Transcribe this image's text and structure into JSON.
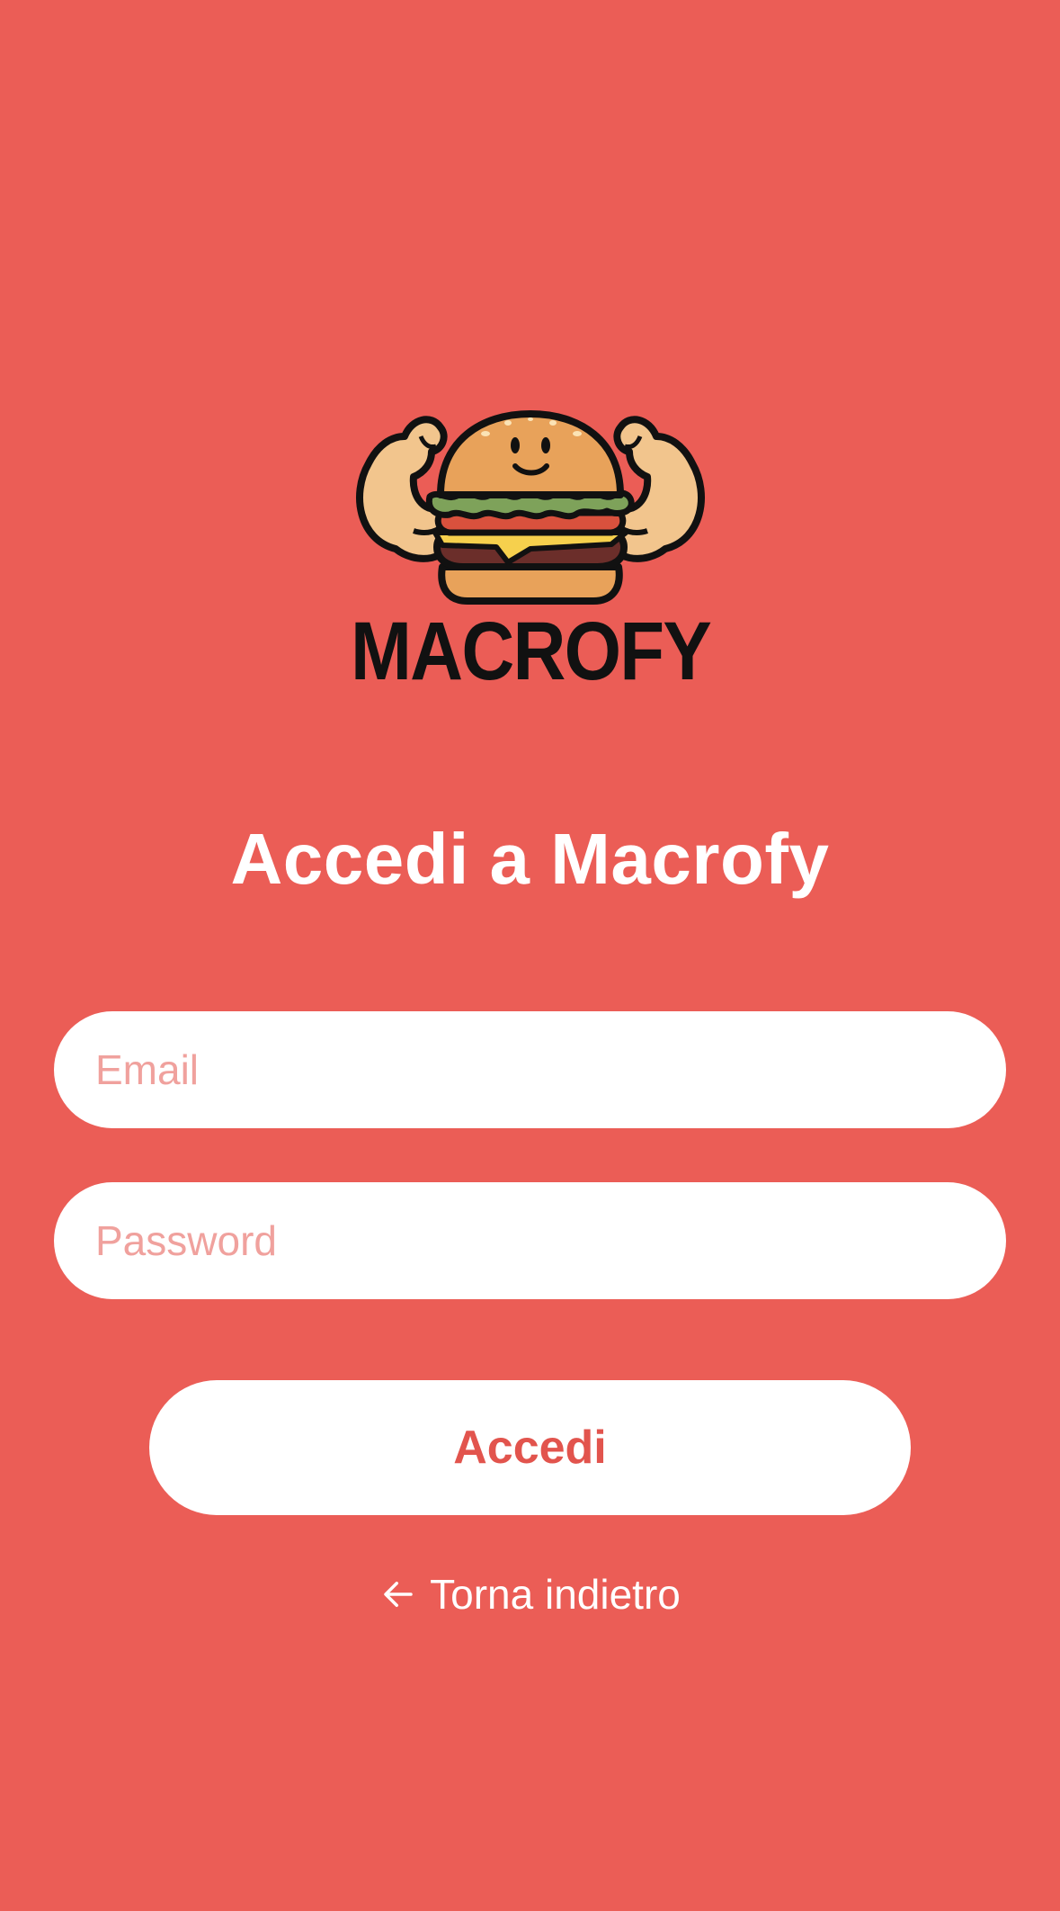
{
  "logo": {
    "wordmark": "MACROFY",
    "icon": "muscular-burger-logo"
  },
  "login": {
    "title": "Accedi a Macrofy",
    "email_placeholder": "Email",
    "email_value": "",
    "password_placeholder": "Password",
    "password_value": "",
    "submit_label": "Accedi",
    "back_label": "Torna indietro",
    "back_icon": "arrow-left-icon"
  },
  "colors": {
    "background": "#EB5D56",
    "accent_text": "#E2544D",
    "placeholder": "#F0A19D",
    "surface": "#FFFFFF"
  }
}
